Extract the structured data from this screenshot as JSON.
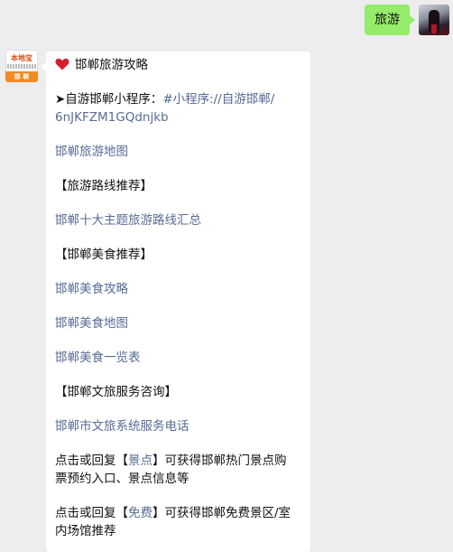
{
  "self": {
    "message": "旅游"
  },
  "bot_avatar": {
    "logo_text": "本地宝",
    "region_text": "邯 郸"
  },
  "reply": {
    "title": "邯郸旅游攻略",
    "mini_program_prefix": "➤自游邯郸小程序：",
    "mini_program_link_a": "#小程序://自游邯郸/",
    "mini_program_link_b": "6nJKFZM1GQdnjkb",
    "link_map": "邯郸旅游地图",
    "heading_route": "【旅游路线推荐】",
    "link_route": "邯郸十大主题旅游路线汇总",
    "heading_food": "【邯郸美食推荐】",
    "link_food_guide": "邯郸美食攻略",
    "link_food_map": "邯郸美食地图",
    "link_food_list": "邯郸美食一览表",
    "heading_service": "【邯郸文旅服务咨询】",
    "link_service_phone": "邯郸市文旅系统服务电话",
    "tip1_prefix": "点击或回复【",
    "tip1_keyword": "景点",
    "tip1_suffix_a": "】可获得邯郸热门景点购",
    "tip1_suffix_b": "票预约入口、景点信息等",
    "tip2_prefix": "点击或回复【",
    "tip2_keyword": "免费",
    "tip2_suffix_a": "】可获得邯郸免费景区/室",
    "tip2_suffix_b": "内场馆推荐"
  },
  "colors": {
    "self_bubble": "#95ec69",
    "link": "#576b95",
    "background": "#ededed"
  }
}
